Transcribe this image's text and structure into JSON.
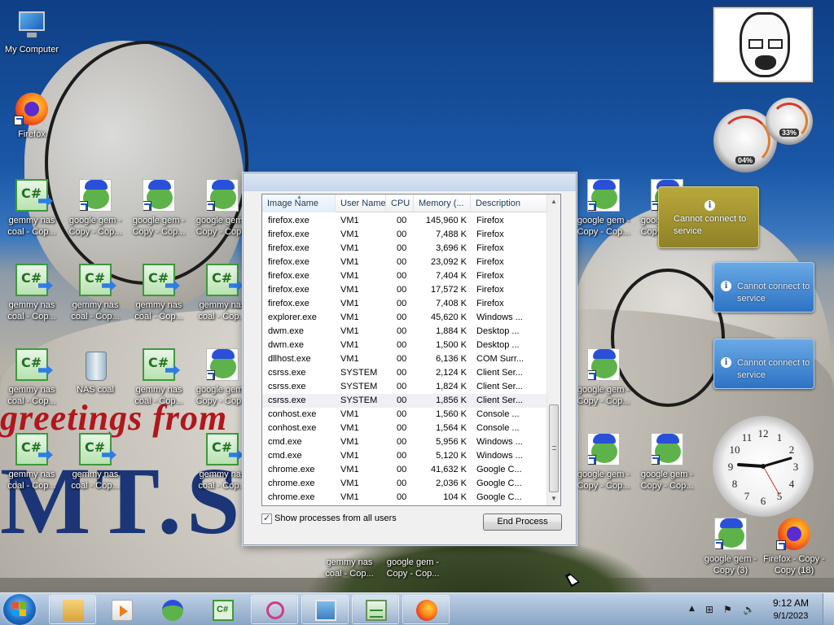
{
  "desktop_icons": [
    {
      "label": "My Computer",
      "kind": "pc"
    },
    {
      "label": "Firefox",
      "kind": "firefox"
    },
    {
      "label": "gemmy nas coal - Cop...",
      "kind": "csharp"
    },
    {
      "label": "google gem - Copy - Cop...",
      "kind": "pepe"
    },
    {
      "label": "google gem - Copy - Cop...",
      "kind": "pepe"
    },
    {
      "label": "google gem - Copy - Cop...",
      "kind": "pepe"
    },
    {
      "label": "gemmy nas coal - Cop...",
      "kind": "csharp"
    },
    {
      "label": "gemmy nas coal - Cop...",
      "kind": "csharp"
    },
    {
      "label": "gemmy nas coal - Cop...",
      "kind": "csharp"
    },
    {
      "label": "gemmy nas coal - Cop...",
      "kind": "csharp"
    },
    {
      "label": "gemmy nas coal - Cop...",
      "kind": "csharp"
    },
    {
      "label": "NAS coal",
      "kind": "recycle-bin"
    },
    {
      "label": "gemmy nas coal - Cop...",
      "kind": "csharp"
    },
    {
      "label": "google gem - Copy - Cop...",
      "kind": "pepe"
    },
    {
      "label": "gemmy nas coal - Cop...",
      "kind": "csharp"
    },
    {
      "label": "gemmy nas coal - Cop...",
      "kind": "csharp"
    },
    {
      "label": "gemmy nas coal - Cop...",
      "kind": "csharp"
    },
    {
      "label": "gemmy nas coal - Cop...",
      "kind": "csharp"
    },
    {
      "label": "google gem - Copy - Cop...",
      "kind": "pepe"
    },
    {
      "label": "google gem - Copy - Cop...",
      "kind": "pepe"
    },
    {
      "label": "google gem - Copy - Cop...",
      "kind": "pepe"
    },
    {
      "label": "google gem - Copy - Cop...",
      "kind": "pepe"
    },
    {
      "label": "google gem - Copy - Cop...",
      "kind": "pepe"
    },
    {
      "label": "google gem - Copy - Cop...",
      "kind": "pepe"
    },
    {
      "label": "google gem - Copy (3)",
      "kind": "pepe"
    },
    {
      "label": "Firefox - Copy - Copy (18)",
      "kind": "firefox"
    }
  ],
  "wallpaper": {
    "line1": "greetings from",
    "line2": "MT.S"
  },
  "gadgets": {
    "meter_cpu": "04%",
    "meter_mem": "33%",
    "feed_message": "Cannot connect to service",
    "weather_message": "Cannot connect to service",
    "info_glyph": "i"
  },
  "task_manager": {
    "columns": [
      "Image Name",
      "User Name",
      "CPU",
      "Memory (...",
      "Description"
    ],
    "sorted_column": "Image Name",
    "processes": [
      [
        "firefox.exe",
        "VM1",
        "00",
        "145,960 K",
        "Firefox"
      ],
      [
        "firefox.exe",
        "VM1",
        "00",
        "7,488 K",
        "Firefox"
      ],
      [
        "firefox.exe",
        "VM1",
        "00",
        "3,696 K",
        "Firefox"
      ],
      [
        "firefox.exe",
        "VM1",
        "00",
        "23,092 K",
        "Firefox"
      ],
      [
        "firefox.exe",
        "VM1",
        "00",
        "7,404 K",
        "Firefox"
      ],
      [
        "firefox.exe",
        "VM1",
        "00",
        "17,572 K",
        "Firefox"
      ],
      [
        "firefox.exe",
        "VM1",
        "00",
        "7,408 K",
        "Firefox"
      ],
      [
        "explorer.exe",
        "VM1",
        "00",
        "45,620 K",
        "Windows ..."
      ],
      [
        "dwm.exe",
        "VM1",
        "00",
        "1,884 K",
        "Desktop ..."
      ],
      [
        "dwm.exe",
        "VM1",
        "00",
        "1,500 K",
        "Desktop ..."
      ],
      [
        "dllhost.exe",
        "VM1",
        "00",
        "6,136 K",
        "COM Surr..."
      ],
      [
        "csrss.exe",
        "SYSTEM",
        "00",
        "2,124 K",
        "Client Ser..."
      ],
      [
        "csrss.exe",
        "SYSTEM",
        "00",
        "1,824 K",
        "Client Ser..."
      ],
      [
        "csrss.exe",
        "SYSTEM",
        "00",
        "1,856 K",
        "Client Ser..."
      ],
      [
        "conhost.exe",
        "VM1",
        "00",
        "1,560 K",
        "Console ..."
      ],
      [
        "conhost.exe",
        "VM1",
        "00",
        "1,564 K",
        "Console ..."
      ],
      [
        "cmd.exe",
        "VM1",
        "00",
        "5,956 K",
        "Windows ..."
      ],
      [
        "cmd.exe",
        "VM1",
        "00",
        "5,120 K",
        "Windows ..."
      ],
      [
        "chrome.exe",
        "VM1",
        "00",
        "41,632 K",
        "Google C..."
      ],
      [
        "chrome.exe",
        "VM1",
        "00",
        "2,036 K",
        "Google C..."
      ],
      [
        "chrome.exe",
        "VM1",
        "00",
        "104 K",
        "Google C..."
      ]
    ],
    "selected_row": 13,
    "show_all_label": "Show processes from all users",
    "show_all_checked": true,
    "end_process_label": "End Process",
    "scroll_up_glyph": "▲",
    "scroll_down_glyph": "▼"
  },
  "taskbar": {
    "pinned": [
      "windows-explorer",
      "media-player",
      "google-gem",
      "gemmy-nas-coal",
      "snipping-tool",
      "image-viewer",
      "task-manager",
      "firefox"
    ],
    "tray_up_glyph": "▲",
    "time": "9:12 AM",
    "date": "9/1/2023"
  },
  "colors": {
    "sky": "#1a57a7",
    "wall_red": "#b3151c",
    "wall_blue": "#1b3577",
    "weather_gadget": "#a89a30",
    "feed_gadget": "#3f83d0"
  }
}
